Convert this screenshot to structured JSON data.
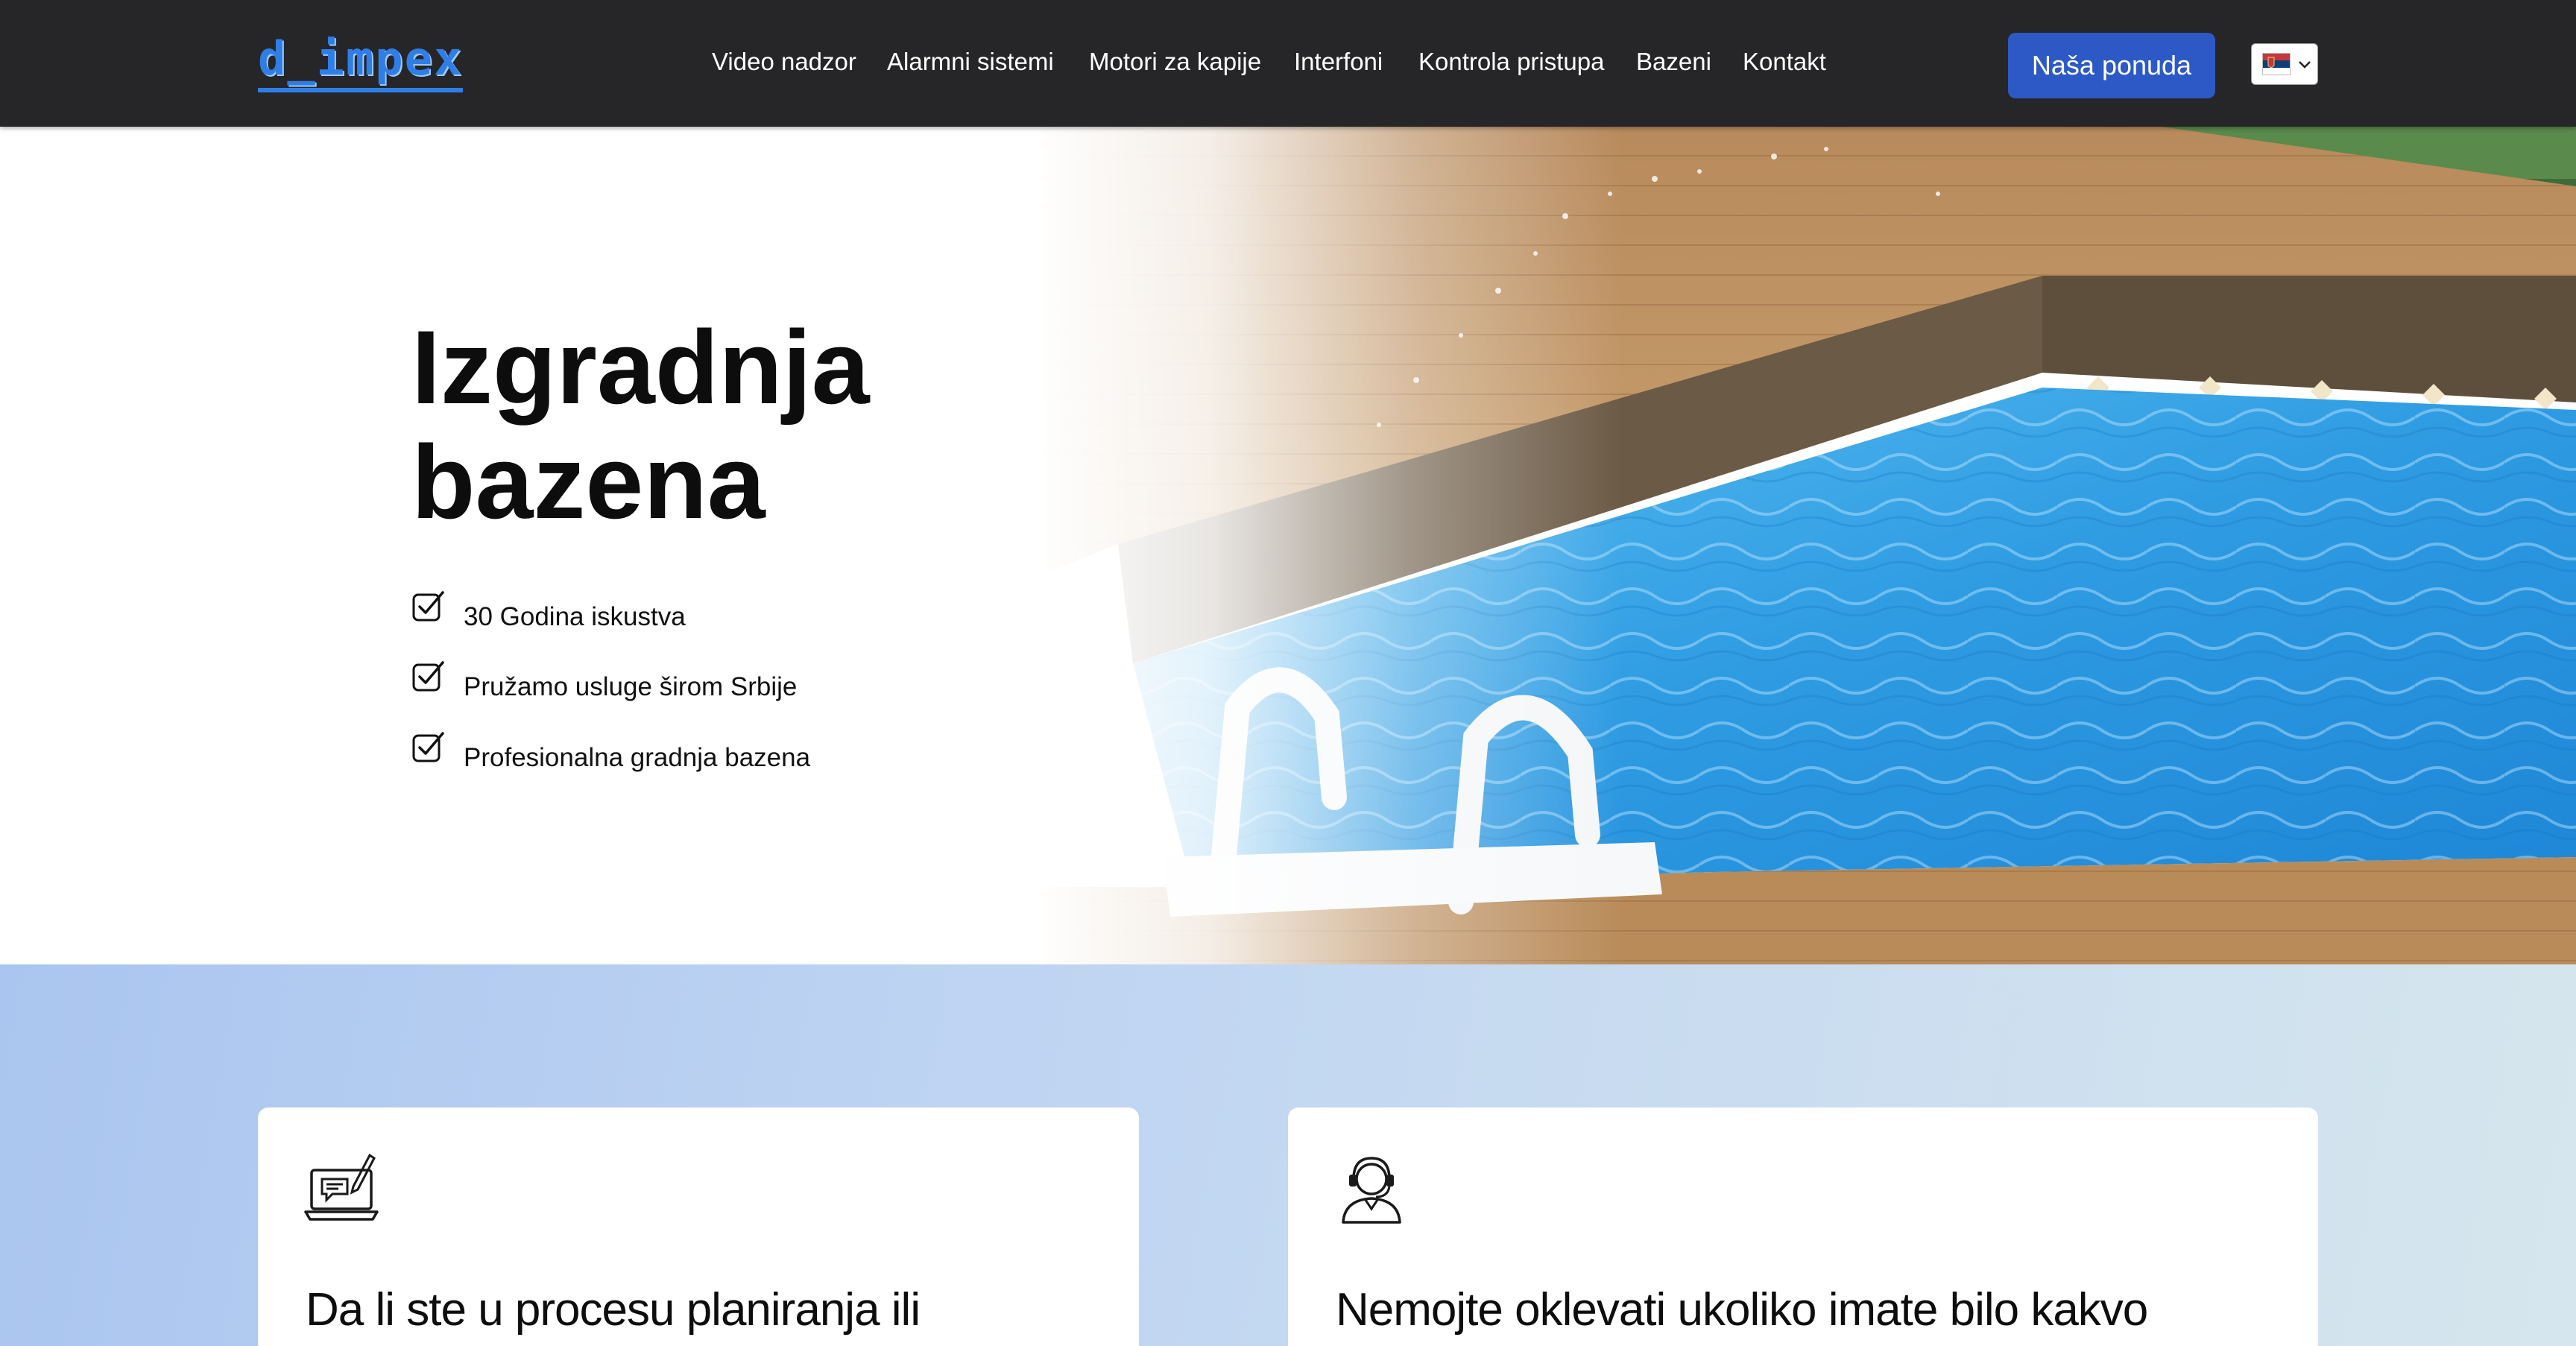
{
  "header": {
    "logo": "d_impex",
    "nav": [
      {
        "label": "Video nadzor"
      },
      {
        "label": "Alarmni sistemi"
      },
      {
        "label": "Motori za kapije"
      },
      {
        "label": "Interfoni"
      },
      {
        "label": "Kontrola pristupa"
      },
      {
        "label": "Bazeni"
      },
      {
        "label": "Kontakt"
      }
    ],
    "cta_label": "Naša ponuda",
    "language_icon": "serbia-flag-icon"
  },
  "hero": {
    "title_line1": "Izgradnja",
    "title_line2": "bazena",
    "features": [
      {
        "text": "30 Godina iskustva",
        "icon": "checkbox-check-icon"
      },
      {
        "text": "Pružamo usluge širom Srbije",
        "icon": "checkbox-check-icon"
      },
      {
        "text": "Profesionalna gradnja bazena",
        "icon": "checkbox-check-icon"
      }
    ]
  },
  "services": {
    "cards": [
      {
        "icon": "laptop-chat-icon",
        "title": "Da li ste u procesu planiranja ili"
      },
      {
        "icon": "support-agent-icon",
        "title": "Nemojte oklevati ukoliko imate bilo kakvo"
      }
    ]
  },
  "colors": {
    "header_bg": "#262628",
    "accent": "#2c59c6",
    "logo": "#2f7ee6",
    "pool_water": "#3aa6e8"
  }
}
